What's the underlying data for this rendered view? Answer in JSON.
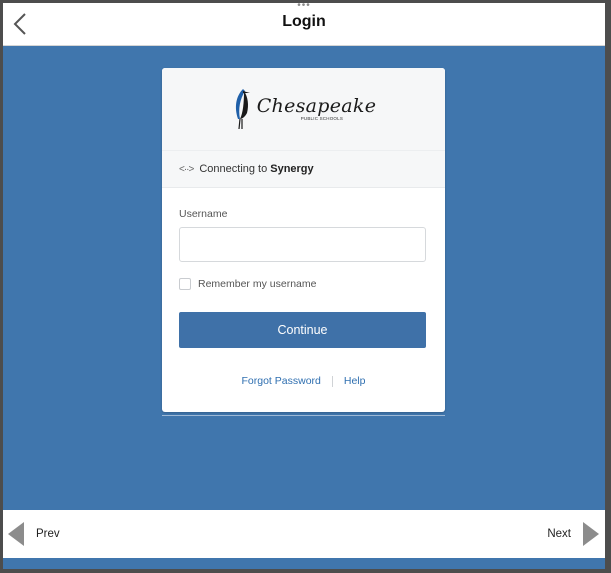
{
  "topbar": {
    "title": "Login",
    "dots": "•••",
    "back_icon": "chevron-left-icon"
  },
  "card": {
    "logo": {
      "main_text": "Chesapeake",
      "sub_text": "PUBLIC SCHOOLS",
      "icon": "heron-logo-icon"
    },
    "connecting": {
      "icon": "arrows-horizontal-icon",
      "arrows_glyph": "<··>",
      "prefix": "Connecting to",
      "target": "Synergy"
    },
    "username": {
      "label": "Username",
      "value": "",
      "placeholder": ""
    },
    "remember": {
      "label": "Remember my username",
      "checked": false
    },
    "continue_label": "Continue",
    "links": {
      "forgot_password": "Forgot Password",
      "help": "Help"
    }
  },
  "bottombar": {
    "prev_label": "Prev",
    "next_label": "Next",
    "prev_icon": "triangle-left-icon",
    "next_icon": "triangle-right-icon"
  },
  "colors": {
    "background": "#4076ad",
    "button": "#3f71a8",
    "link": "#2f6fb0",
    "nav_arrow": "#8c8c8c"
  }
}
